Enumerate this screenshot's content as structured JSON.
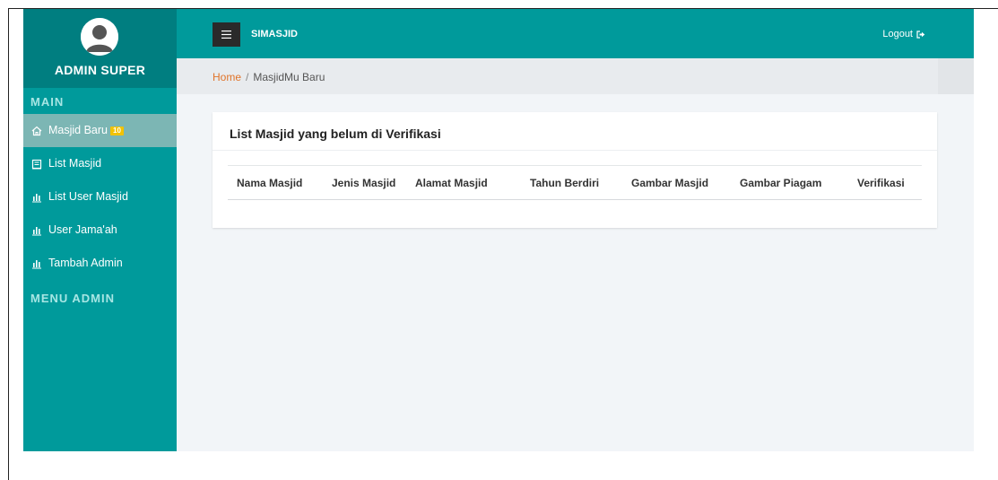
{
  "sidebar": {
    "profile_name": "ADMIN SUPER",
    "section_main": "MAIN",
    "section_menu_admin": "MENU ADMIN",
    "items": [
      {
        "label": "Masjid Baru",
        "icon": "home-icon",
        "badge": "10",
        "active": true
      },
      {
        "label": "List Masjid",
        "icon": "building-icon"
      },
      {
        "label": "List User Masjid",
        "icon": "bar-chart-icon"
      },
      {
        "label": "User Jama'ah",
        "icon": "bar-chart-icon"
      },
      {
        "label": "Tambah Admin",
        "icon": "bar-chart-icon"
      }
    ]
  },
  "topbar": {
    "app_name": "SIMASJID",
    "logout_label": "Logout",
    "menu_icon": "hamburger-icon",
    "logout_icon": "sign-out-icon"
  },
  "breadcrumb": {
    "home": "Home",
    "separator": "/",
    "current": "MasjidMu Baru"
  },
  "card": {
    "title": "List Masjid yang belum di Verifikasi",
    "columns": [
      "Nama Masjid",
      "Jenis Masjid",
      "Alamat Masjid",
      "Tahun Berdiri",
      "Gambar Masjid",
      "Gambar Piagam",
      "Verifikasi"
    ]
  },
  "colors": {
    "sidebar": "#009a9b",
    "sidebar_profile": "#007e80",
    "active_item": "#7cb6b4",
    "badge": "#f2c200",
    "breadcrumb_link": "#e0742a"
  }
}
